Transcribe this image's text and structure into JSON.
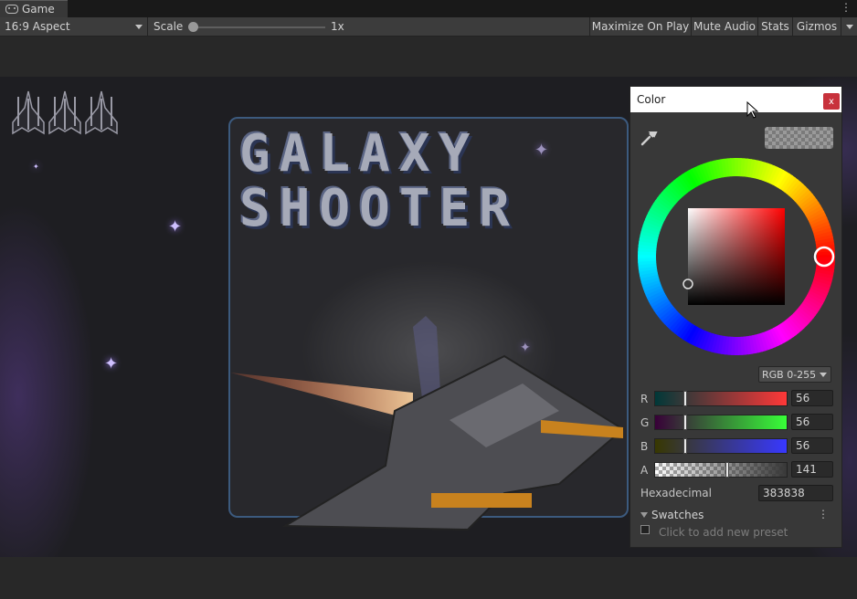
{
  "tab": {
    "label": "Game"
  },
  "toolbar": {
    "aspect": "16:9 Aspect",
    "scale_label": "Scale",
    "scale_value": "1x",
    "buttons": [
      "Maximize On Play",
      "Mute Audio",
      "Stats",
      "Gizmos"
    ]
  },
  "game": {
    "title_line1": "GALAXY",
    "title_line2": "SHOOTER",
    "lives": 3
  },
  "color_window": {
    "title": "Color",
    "close_label": "x",
    "mode": "RGB 0-255",
    "channels": [
      {
        "label": "R",
        "value": "56",
        "level": 0.22
      },
      {
        "label": "G",
        "value": "56",
        "level": 0.22
      },
      {
        "label": "B",
        "value": "56",
        "level": 0.22
      },
      {
        "label": "A",
        "value": "141",
        "level": 0.553
      }
    ],
    "hex_label": "Hexadecimal",
    "hex_value": "383838",
    "swatches_label": "Swatches",
    "swatches_hint": "Click to add new preset"
  },
  "colors": {
    "current": "#383838",
    "close_red": "#c8323c",
    "panel_border": "#3c5a7e"
  }
}
